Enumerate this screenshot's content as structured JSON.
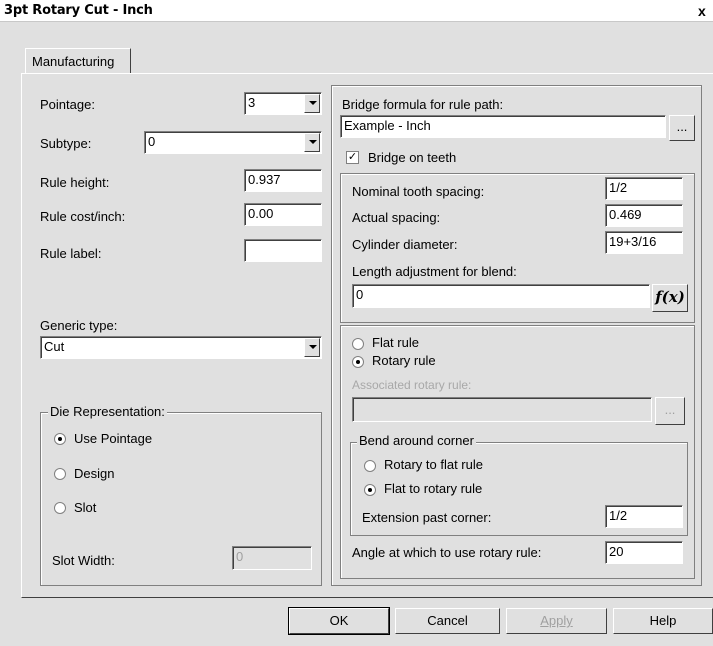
{
  "window": {
    "title": "3pt Rotary Cut - Inch",
    "close": "x"
  },
  "tabs": [
    {
      "label": "Manufacturing"
    }
  ],
  "left": {
    "pointage": {
      "label": "Pointage:",
      "value": "3"
    },
    "subtype": {
      "label": "Subtype:",
      "value": "0"
    },
    "rule_height": {
      "label": "Rule height:",
      "value": "0.937"
    },
    "rule_cost": {
      "label": "Rule cost/inch:",
      "value": "0.00"
    },
    "rule_label": {
      "label": "Rule label:",
      "value": ""
    },
    "generic_type": {
      "label": "Generic type:",
      "value": "Cut"
    },
    "die_rep": {
      "legend": "Die Representation:",
      "options": [
        "Use Pointage",
        "Design",
        "Slot"
      ],
      "selected": "Use Pointage",
      "slot_width": {
        "label": "Slot Width:",
        "value": "0"
      }
    }
  },
  "right": {
    "bridge_formula": {
      "label": "Bridge formula for rule path:",
      "value": "Example - Inch",
      "browse": "..."
    },
    "bridge_on_teeth": {
      "label": "Bridge on teeth",
      "checked": true,
      "mark": "✓"
    },
    "nominal_tooth_spacing": {
      "label": "Nominal tooth spacing:",
      "value": "1/2"
    },
    "actual_spacing": {
      "label": "Actual spacing:",
      "value": "0.469"
    },
    "cylinder_diameter": {
      "label": "Cylinder diameter:",
      "value": "19+3/16"
    },
    "length_adjustment": {
      "label": "Length adjustment for blend:",
      "value": "0",
      "fx": "f(x)"
    },
    "rule_kind": {
      "options": [
        "Flat rule",
        "Rotary rule"
      ],
      "selected": "Rotary rule"
    },
    "associated_rotary": {
      "label": "Associated rotary rule:",
      "value": "",
      "browse": "..."
    },
    "bend_group": {
      "legend": "Bend around corner",
      "options": [
        "Rotary to flat rule",
        "Flat to rotary rule"
      ],
      "selected": "Flat to rotary rule",
      "extension": {
        "label": "Extension past corner:",
        "value": "1/2"
      }
    },
    "angle": {
      "label": "Angle at which to use rotary rule:",
      "value": "20"
    }
  },
  "buttons": {
    "ok": "OK",
    "cancel": "Cancel",
    "apply": "Apply",
    "help": "Help"
  }
}
